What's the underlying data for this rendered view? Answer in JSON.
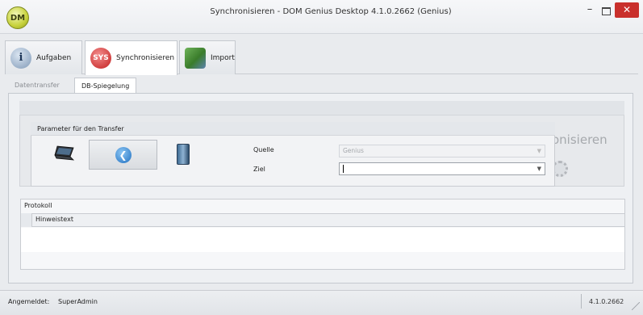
{
  "window": {
    "title": "Synchronisieren - DOM Genius Desktop 4.1.0.2662 (Genius)",
    "logo_text": "DM",
    "minimize_glyph": "–",
    "close_glyph": "✕"
  },
  "main_tabs": [
    {
      "label": "Aufgaben",
      "icon": "info-icon",
      "icon_glyph": "i"
    },
    {
      "label": "Synchronisieren",
      "icon": "sync-icon",
      "icon_glyph": "SYS",
      "active": true
    },
    {
      "label": "Import",
      "icon": "import-icon",
      "icon_glyph": ""
    }
  ],
  "sub_tabs": [
    {
      "label": "Datentransfer",
      "active": false
    },
    {
      "label": "DB-Spiegelung",
      "active": true
    }
  ],
  "parameter_group": {
    "title": "Parameter für den Transfer",
    "back_glyph": "❮",
    "quelle": {
      "label": "Quelle",
      "value": "Genius",
      "enabled": false
    },
    "ziel": {
      "label": "Ziel",
      "value": ""
    }
  },
  "ghost_sync_label": "onisieren",
  "protokoll": {
    "title": "Protokoll",
    "columns": [
      "Hinweistext"
    ],
    "rows": []
  },
  "statusbar": {
    "user_label": "Angemeldet:",
    "user_value": "SuperAdmin",
    "version": "4.1.0.2662"
  },
  "colors": {
    "accent_close": "#c9302c",
    "logo": "#c7d23c"
  }
}
